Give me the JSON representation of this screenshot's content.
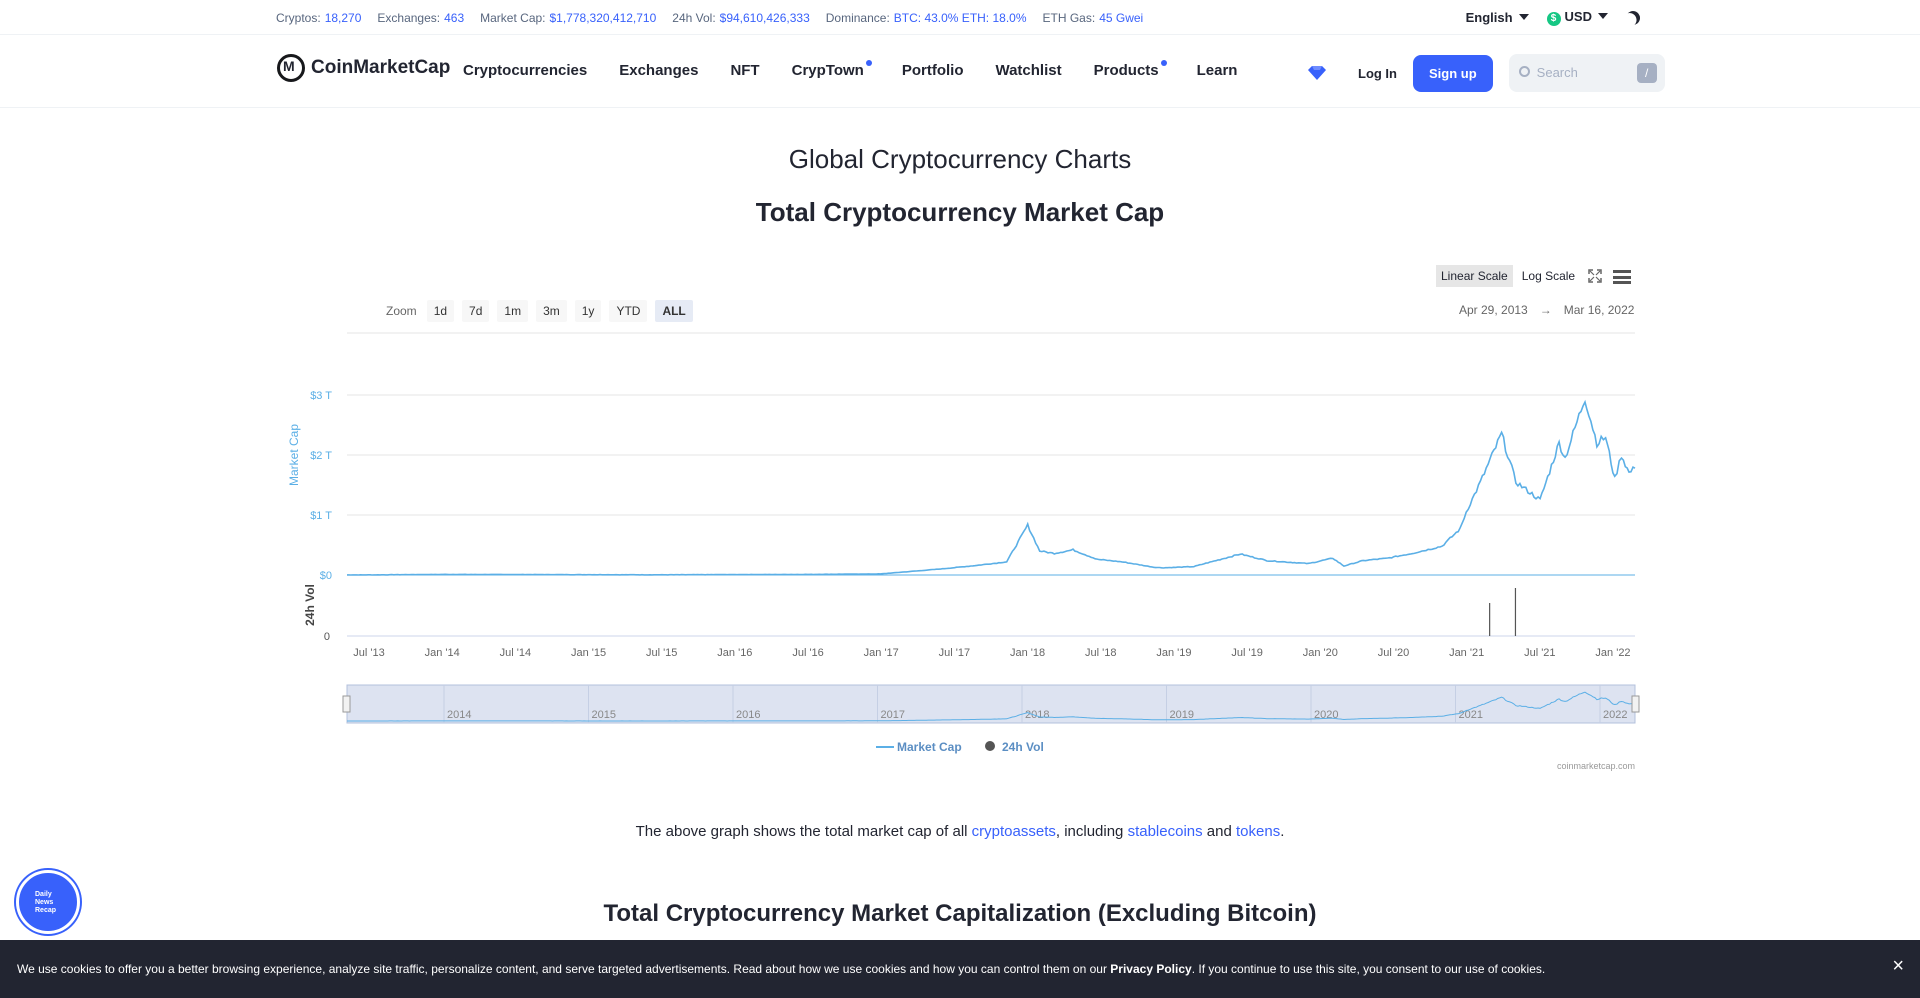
{
  "stats": [
    {
      "label": "Cryptos:",
      "value": "18,270"
    },
    {
      "label": "Exchanges:",
      "value": "463"
    },
    {
      "label": "Market Cap:",
      "value": "$1,778,320,412,710"
    },
    {
      "label": "24h Vol:",
      "value": "$94,610,426,333"
    },
    {
      "label": "Dominance:",
      "value": "BTC: 43.0% ETH: 18.0%"
    },
    {
      "label": "ETH Gas:",
      "value": "45 Gwei"
    }
  ],
  "language": "English",
  "currency": "USD",
  "currency_symbol": "$",
  "logo_text": "CoinMarketCap",
  "nav": [
    {
      "label": "Cryptocurrencies",
      "dot": false
    },
    {
      "label": "Exchanges",
      "dot": false
    },
    {
      "label": "NFT",
      "dot": false
    },
    {
      "label": "CrypTown",
      "dot": true
    },
    {
      "label": "Portfolio",
      "dot": false
    },
    {
      "label": "Watchlist",
      "dot": false
    },
    {
      "label": "Products",
      "dot": true
    },
    {
      "label": "Learn",
      "dot": false
    }
  ],
  "login": "Log In",
  "signup": "Sign up",
  "search": {
    "placeholder": "Search",
    "shortcut": "/"
  },
  "page_title": "Global Cryptocurrency Charts",
  "section_title": "Total Cryptocurrency Market Cap",
  "scale": {
    "linear": "Linear Scale",
    "log": "Log Scale",
    "active": "linear"
  },
  "zoom": {
    "label": "Zoom",
    "options": [
      "1d",
      "7d",
      "1m",
      "3m",
      "1y",
      "YTD",
      "ALL"
    ],
    "active": "ALL"
  },
  "range": {
    "from": "Apr 29, 2013",
    "arrow": "→",
    "to": "Mar 16, 2022"
  },
  "chart_data": {
    "type": "line",
    "ylabel": "Market Cap",
    "y2label": "24h Vol",
    "yticks": [
      "$0",
      "$1 T",
      "$2 T",
      "$3 T"
    ],
    "y2ticks": [
      "0"
    ],
    "ylim": [
      0,
      3.2
    ],
    "xticks": [
      "Jul '13",
      "Jan '14",
      "Jul '14",
      "Jan '15",
      "Jul '15",
      "Jan '16",
      "Jul '16",
      "Jan '17",
      "Jul '17",
      "Jan '18",
      "Jul '18",
      "Jan '19",
      "Jul '19",
      "Jan '20",
      "Jul '20",
      "Jan '21",
      "Jul '21",
      "Jan '22"
    ],
    "x": [
      "2013-04-29",
      "2013-07-01",
      "2014-01-01",
      "2014-07-01",
      "2015-01-01",
      "2015-07-01",
      "2016-01-01",
      "2016-07-01",
      "2017-01-01",
      "2017-06-01",
      "2017-09-01",
      "2017-11-15",
      "2018-01-07",
      "2018-02-06",
      "2018-03-15",
      "2018-05-01",
      "2018-07-01",
      "2018-09-01",
      "2018-11-20",
      "2018-12-15",
      "2019-03-01",
      "2019-06-26",
      "2019-09-01",
      "2019-12-15",
      "2020-02-14",
      "2020-03-13",
      "2020-05-01",
      "2020-07-01",
      "2020-09-01",
      "2020-11-15",
      "2020-12-31",
      "2021-01-15",
      "2021-02-20",
      "2021-04-14",
      "2021-05-20",
      "2021-07-20",
      "2021-09-06",
      "2021-09-21",
      "2021-11-10",
      "2021-12-10",
      "2022-01-01",
      "2022-01-24",
      "2022-02-10",
      "2022-03-01",
      "2022-03-16"
    ],
    "values": [
      0.002,
      0.002,
      0.01,
      0.008,
      0.005,
      0.003,
      0.007,
      0.01,
      0.018,
      0.1,
      0.16,
      0.22,
      0.83,
      0.4,
      0.36,
      0.42,
      0.26,
      0.22,
      0.13,
      0.12,
      0.14,
      0.35,
      0.24,
      0.19,
      0.28,
      0.15,
      0.24,
      0.28,
      0.36,
      0.48,
      0.77,
      1.05,
      1.55,
      2.35,
      1.55,
      1.25,
      2.2,
      1.95,
      2.95,
      2.2,
      2.3,
      1.6,
      2.0,
      1.7,
      1.78
    ],
    "vol_spikes": [
      {
        "x": "2021-03-15",
        "value": 0.55
      },
      {
        "x": "2021-05-19",
        "value": 0.8
      }
    ],
    "legend": [
      "Market Cap",
      "24h Vol"
    ],
    "navigator_years": [
      "2014",
      "2015",
      "2016",
      "2017",
      "2018",
      "2019",
      "2020",
      "2021",
      "2022"
    ],
    "credit": "coinmarketcap.com",
    "colors": {
      "line": "#5bafe6",
      "vol": "#555555",
      "grid": "#e6e6e6",
      "navigator": "#dde3f1"
    }
  },
  "caption": {
    "pre": "The above graph shows the total market cap of all ",
    "link1": "cryptoassets",
    "mid1": ", including ",
    "link2": "stablecoins",
    "mid2": " and ",
    "link3": "tokens",
    "post": "."
  },
  "next_section_title": "Total Cryptocurrency Market Capitalization (Excluding Bitcoin)",
  "news_badge": [
    "Daily",
    "News",
    "Recap"
  ],
  "cookie": {
    "pre": "We use cookies to offer you a better browsing experience, analyze site traffic, personalize content, and serve targeted advertisements. Read about how we use cookies and how you can control them on our ",
    "link": "Privacy Policy",
    "post": ". If you continue to use this site, you consent to our use of cookies.",
    "close": "×"
  }
}
